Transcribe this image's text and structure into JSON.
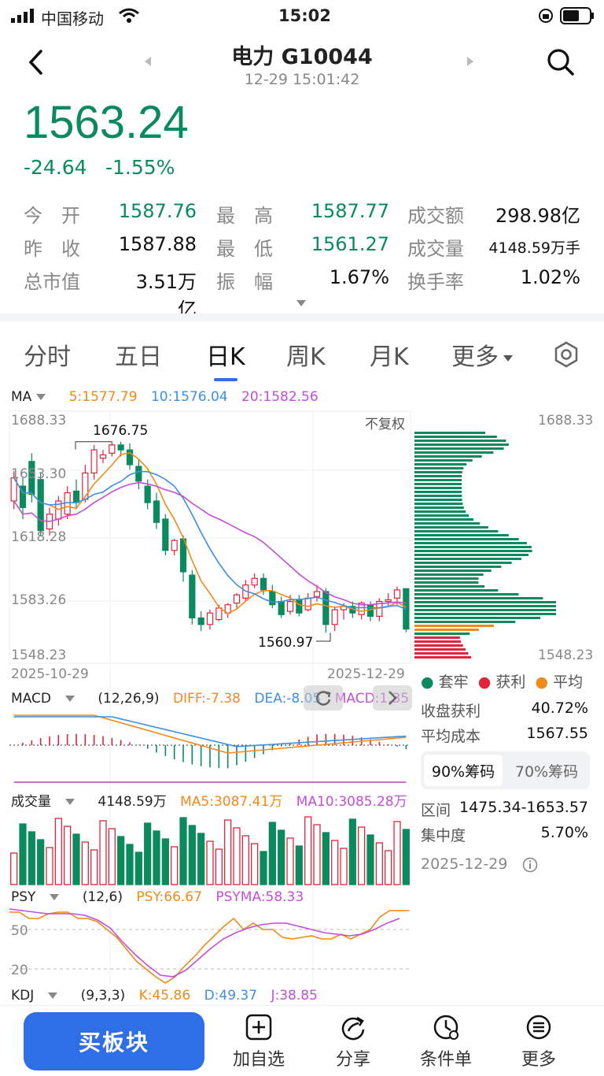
{
  "status_bar": {
    "carrier": "中国移动",
    "time": "15:02"
  },
  "header": {
    "title": "电力 G10044",
    "subtitle": "12-29 15:01:42"
  },
  "quote": {
    "price": "1563.24",
    "change": "-24.64",
    "change_pct": "-1.55%"
  },
  "stats": [
    {
      "label": "今　开",
      "value": "1587.76",
      "color": "green"
    },
    {
      "label": "最　高",
      "value": "1587.77",
      "color": "green"
    },
    {
      "label": "成交额",
      "value": "298.98亿",
      "color": "black"
    },
    {
      "label": "昨　收",
      "value": "1587.88",
      "color": "black"
    },
    {
      "label": "最　低",
      "value": "1561.27",
      "color": "green"
    },
    {
      "label": "成交量",
      "value": "4148.59万手",
      "color": "black"
    },
    {
      "label": "总市值",
      "value": "3.51万亿",
      "color": "black"
    },
    {
      "label": "振　幅",
      "value": "1.67%",
      "color": "black"
    },
    {
      "label": "换手率",
      "value": "1.02%",
      "color": "black"
    }
  ],
  "tabs": [
    "分时",
    "五日",
    "日K",
    "周K",
    "月K",
    "更多"
  ],
  "ma": {
    "label": "MA",
    "ma5": "5:1577.79",
    "ma10": "10:1576.04",
    "ma20": "20:1582.56",
    "no_adjust": "不复权"
  },
  "price_axis": {
    "top": "1688.33",
    "mid1": "1653.30",
    "mid2": "1618.28",
    "mid3": "1583.26",
    "bottom": "1548.23",
    "high_label": "1676.75",
    "low_label": "1560.97"
  },
  "chips_axis": {
    "top": "1688.33",
    "bottom": "1548.23"
  },
  "dates": {
    "start": "2025-10-29",
    "end": "2025-12-29"
  },
  "chip_legend": {
    "trapped": "套牢",
    "profit": "获利",
    "average": "平均"
  },
  "chip_stats": {
    "profit_label": "收盘获利",
    "profit_value": "40.72%",
    "cost_label": "平均成本",
    "cost_value": "1567.55",
    "tab90": "90%筹码",
    "tab70": "70%筹码",
    "range_label": "区间",
    "range_value": "1475.34-1653.57",
    "conc_label": "集中度",
    "conc_value": "5.70%",
    "date": "2025-12-29"
  },
  "macd": {
    "label": "MACD",
    "params": "(12,26,9)",
    "diff": "DIFF:-7.38",
    "dea": "DEA:-8.05",
    "macd": "MACD:1.35"
  },
  "volume": {
    "label": "成交量",
    "value": "4148.59万",
    "ma5": "MA5:3087.41万",
    "ma10": "MA10:3085.28万"
  },
  "psy": {
    "label": "PSY",
    "params": "(12,6)",
    "psy": "PSY:66.67",
    "psyma": "PSYMA:58.33",
    "tick50": "50",
    "tick20": "20"
  },
  "kdj": {
    "label": "KDJ",
    "params": "(9,3,3)",
    "k": "K:45.86",
    "d": "D:49.37",
    "j": "J:38.85"
  },
  "bottom": {
    "buy": "买板块",
    "watch": "加自选",
    "share": "分享",
    "condition": "条件单",
    "more": "更多"
  },
  "colors": {
    "up": "#e0243a",
    "down": "#0b8a5d",
    "ma5": "#f08a1a",
    "ma10": "#3d8fe0",
    "ma20": "#c24fd8",
    "accent": "#2f6fe6"
  },
  "chart_data": {
    "type": "candlestick",
    "ylim": [
      1548.23,
      1688.33
    ],
    "candles": [
      [
        1641,
        1655,
        1636,
        1659
      ],
      [
        1650,
        1637,
        1630,
        1655
      ],
      [
        1665,
        1645,
        1640,
        1670
      ],
      [
        1654,
        1623,
        1620,
        1658
      ],
      [
        1624,
        1633,
        1620,
        1637
      ],
      [
        1630,
        1641,
        1626,
        1644
      ],
      [
        1633,
        1646,
        1630,
        1650
      ],
      [
        1647,
        1640,
        1636,
        1654
      ],
      [
        1642,
        1658,
        1640,
        1663
      ],
      [
        1658,
        1672,
        1654,
        1675
      ],
      [
        1667,
        1669,
        1664,
        1672
      ],
      [
        1670,
        1675,
        1668,
        1677
      ],
      [
        1675,
        1672,
        1668,
        1677
      ],
      [
        1672,
        1663,
        1660,
        1676
      ],
      [
        1662,
        1653,
        1648,
        1666
      ],
      [
        1650,
        1640,
        1636,
        1654
      ],
      [
        1641,
        1628,
        1624,
        1646
      ],
      [
        1630,
        1611,
        1608,
        1633
      ],
      [
        1611,
        1617,
        1608,
        1618
      ],
      [
        1618,
        1598,
        1592,
        1620
      ],
      [
        1596,
        1570,
        1566,
        1599
      ],
      [
        1570,
        1566,
        1562,
        1574
      ],
      [
        1566,
        1573,
        1563,
        1575
      ],
      [
        1569,
        1576,
        1568,
        1578
      ],
      [
        1573,
        1578,
        1570,
        1579
      ],
      [
        1579,
        1584,
        1576,
        1585
      ],
      [
        1582,
        1590,
        1580,
        1593
      ],
      [
        1590,
        1594,
        1588,
        1597
      ],
      [
        1594,
        1587,
        1584,
        1597
      ],
      [
        1586,
        1578,
        1576,
        1590
      ],
      [
        1580,
        1572,
        1570,
        1583
      ],
      [
        1574,
        1580,
        1572,
        1584
      ],
      [
        1581,
        1573,
        1571,
        1584
      ],
      [
        1575,
        1582,
        1574,
        1585
      ],
      [
        1583,
        1586,
        1580,
        1590
      ],
      [
        1586,
        1566,
        1561,
        1588
      ],
      [
        1566,
        1575,
        1562,
        1577
      ],
      [
        1575,
        1577,
        1569,
        1579
      ],
      [
        1577,
        1573,
        1570,
        1580
      ],
      [
        1572,
        1579,
        1569,
        1580
      ],
      [
        1578,
        1571,
        1568,
        1580
      ],
      [
        1571,
        1580,
        1568,
        1582
      ],
      [
        1580,
        1581,
        1577,
        1585
      ],
      [
        1582,
        1587,
        1578,
        1589
      ],
      [
        1587.76,
        1563.24,
        1561.27,
        1587.77
      ]
    ]
  }
}
